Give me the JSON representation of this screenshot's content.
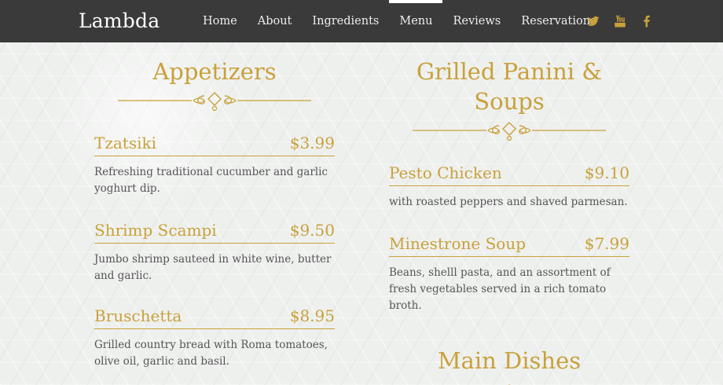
{
  "brand": "Lambda",
  "nav": {
    "links": [
      "Home",
      "About",
      "Ingredients",
      "Menu",
      "Reviews",
      "Reservations"
    ],
    "active": "Menu"
  },
  "social": [
    "twitter-icon",
    "youtube-icon",
    "facebook-icon"
  ],
  "colors": {
    "navbar": "#3a3a3a",
    "accent": "#c9a13b",
    "body_text": "#555555"
  },
  "sections": {
    "appetizers": {
      "title": "Appetizers",
      "items": [
        {
          "name": "Tzatsiki",
          "price": "$3.99",
          "desc": "Refreshing traditional cucumber and garlic yoghurt dip."
        },
        {
          "name": "Shrimp Scampi",
          "price": "$9.50",
          "desc": "Jumbo shrimp sauteed in white wine, butter and garlic."
        },
        {
          "name": "Bruschetta",
          "price": "$8.95",
          "desc": "Grilled country bread with Roma tomatoes, olive oil, garlic and basil."
        }
      ]
    },
    "panini": {
      "title_line1": "Grilled Panini &",
      "title_line2": "Soups",
      "items": [
        {
          "name": "Pesto Chicken",
          "price": "$9.10",
          "desc": "with roasted peppers and shaved parmesan."
        },
        {
          "name": "Minestrone Soup",
          "price": "$7.99",
          "desc": "Beans, shelll pasta, and an assortment of fresh vegetables served in a rich tomato broth."
        }
      ]
    },
    "main": {
      "title": "Main Dishes"
    }
  }
}
